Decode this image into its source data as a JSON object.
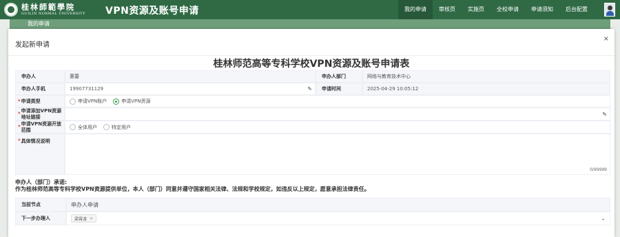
{
  "header": {
    "logo_cn": "桂林師範學院",
    "logo_en": "GUILIN NORMAL UNIVERSITY",
    "app_title": "VPN资源及账号申请",
    "nav": [
      "我的申请",
      "审核页",
      "实施页",
      "全校申请",
      "申请须知",
      "后台配置"
    ],
    "active_nav": "我的申请"
  },
  "breadcrumb": "我的申请",
  "modal": {
    "title": "发起新申请",
    "close": "×",
    "form_title": "桂林师范高等专科学校VPN资源及账号申请表"
  },
  "form": {
    "applicant_label": "申办人",
    "applicant_value": "惠蕾",
    "dept_label": "申办人部门",
    "dept_value": "网络与教育技术中心",
    "phone_label": "申办人手机",
    "phone_value": "19907731129",
    "time_label": "申请时间",
    "time_value": "2025-04-29 10:05:12",
    "type_label": "申请类型",
    "type_options": [
      "申请VPN账户",
      "申请VPN资源"
    ],
    "type_selected": "申请VPN资源",
    "url_label": "申请添加VPN资源地址链接",
    "url_value": "",
    "scope_label": "申请VPN资源开放范围",
    "scope_options": [
      "全体用户",
      "特定用户"
    ],
    "detail_label": "具体情况说明",
    "detail_value": "",
    "detail_counter": "0/99999"
  },
  "promise": {
    "line1": "申办人（部门）承诺:",
    "line2": "作为桂林师范高等专科学校VPN资源提供单位，本人（部门）同意并遵守国家相关法律、法规和学校规定，如违反以上规定，愿意承担法律责任。"
  },
  "flow": {
    "node_label": "当前节点",
    "node_value": "申办人申请",
    "next_label": "下一步办理人",
    "next_tag": "梁霄凌",
    "next_tag_remove": "×"
  },
  "icons": {
    "pen": "pencil-icon",
    "chevron": "chevron-down-icon",
    "close": "close-icon"
  },
  "colors": {
    "header": "#2f6a45",
    "breadcrumb": "#6f9e7b",
    "accent": "#3a9a4a"
  }
}
